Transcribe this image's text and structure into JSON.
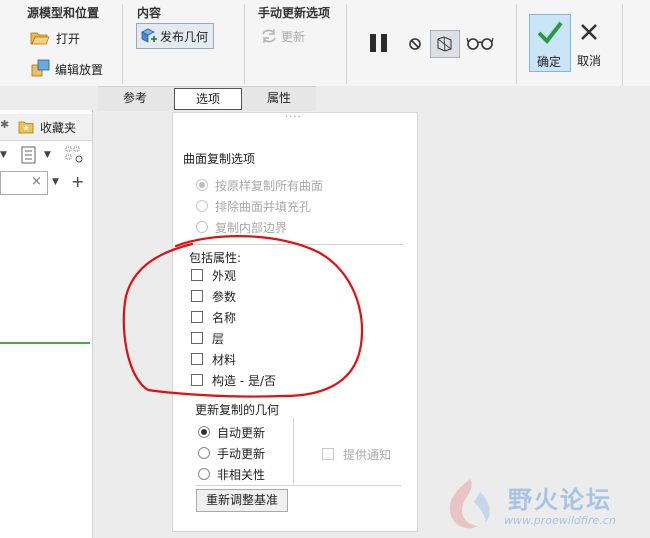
{
  "ribbon": {
    "source_group": {
      "title": "源模型和位置",
      "open_label": "打开",
      "edit_placement_label": "编辑放置"
    },
    "content_group": {
      "title": "内容",
      "publish_geometry_label": "发布几何"
    },
    "manual_update_group": {
      "title": "手动更新选项",
      "update_label": "更新"
    },
    "ok_label": "确定",
    "cancel_label": "取消"
  },
  "tabs": [
    {
      "label": "参考"
    },
    {
      "label": "选项",
      "active": true
    },
    {
      "label": "属性"
    }
  ],
  "left_pane": {
    "favorites_label": "收藏夹",
    "search_value": ""
  },
  "options_panel": {
    "surface_copy_title": "曲面复制选项",
    "surface_copy_options": [
      {
        "label": "按原样复制所有曲面",
        "selected": true,
        "enabled": false
      },
      {
        "label": "排除曲面并填充孔",
        "selected": false,
        "enabled": false
      },
      {
        "label": "复制内部边界",
        "selected": false,
        "enabled": false
      }
    ],
    "include_attributes_title": "包括属性:",
    "attributes": [
      {
        "label": "外观",
        "checked": false
      },
      {
        "label": "参数",
        "checked": false
      },
      {
        "label": "名称",
        "checked": false
      },
      {
        "label": "层",
        "checked": false
      },
      {
        "label": "材料",
        "checked": false
      },
      {
        "label": "构造 - 是/否",
        "checked": false
      }
    ],
    "update_title": "更新复制的几何",
    "update_options": [
      {
        "label": "自动更新",
        "selected": true
      },
      {
        "label": "手动更新",
        "selected": false
      },
      {
        "label": "非相关性",
        "selected": false
      }
    ],
    "notify_label": "提供通知",
    "realign_button_label": "重新调整基准"
  },
  "watermark": {
    "text": "野火论坛",
    "url": "www.proewildfire.cn"
  },
  "colors": {
    "annotation_circle": "#e01010",
    "ok_button_bg": "#c9e4f6",
    "ok_check": "#2a9a3a",
    "left_pane_green_line": "#3cb043"
  }
}
